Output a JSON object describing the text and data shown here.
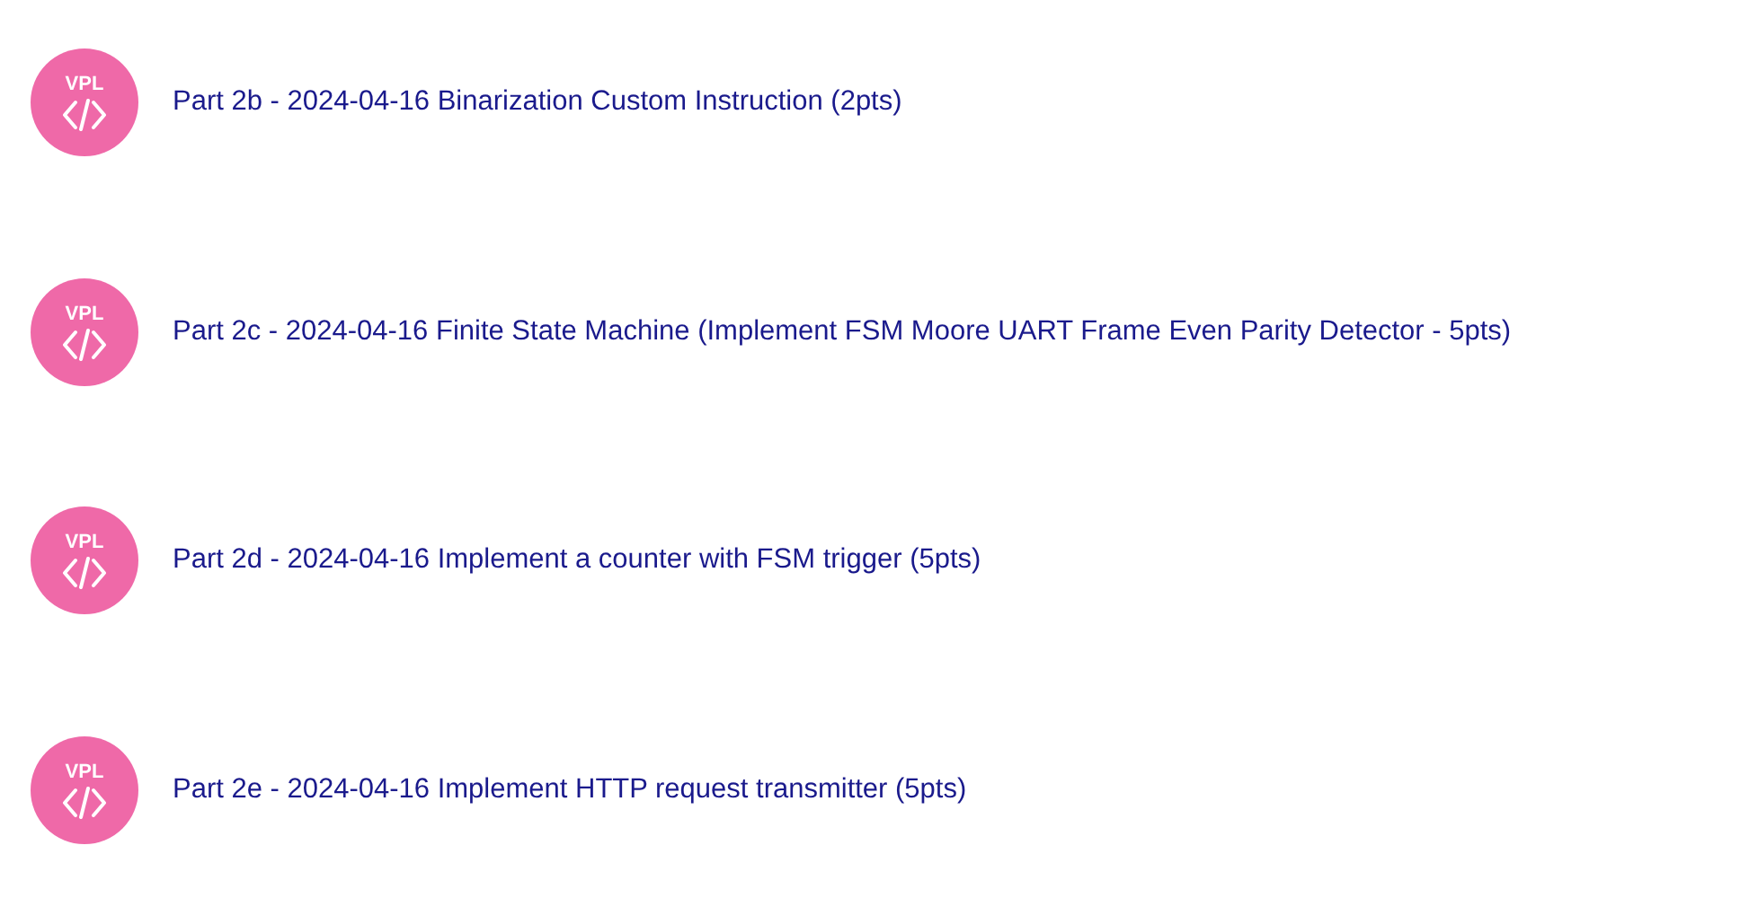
{
  "activities": [
    {
      "badge": "VPL",
      "title": "Part 2b - 2024-04-16 Binarization Custom Instruction (2pts)"
    },
    {
      "badge": "VPL",
      "title": "Part 2c - 2024-04-16 Finite State Machine (Implement FSM Moore UART Frame Even Parity Detector - 5pts)"
    },
    {
      "badge": "VPL",
      "title": "Part 2d - 2024-04-16 Implement a counter with FSM trigger (5pts)"
    },
    {
      "badge": "VPL",
      "title": "Part 2e - 2024-04-16 Implement HTTP request transmitter (5pts)"
    }
  ]
}
